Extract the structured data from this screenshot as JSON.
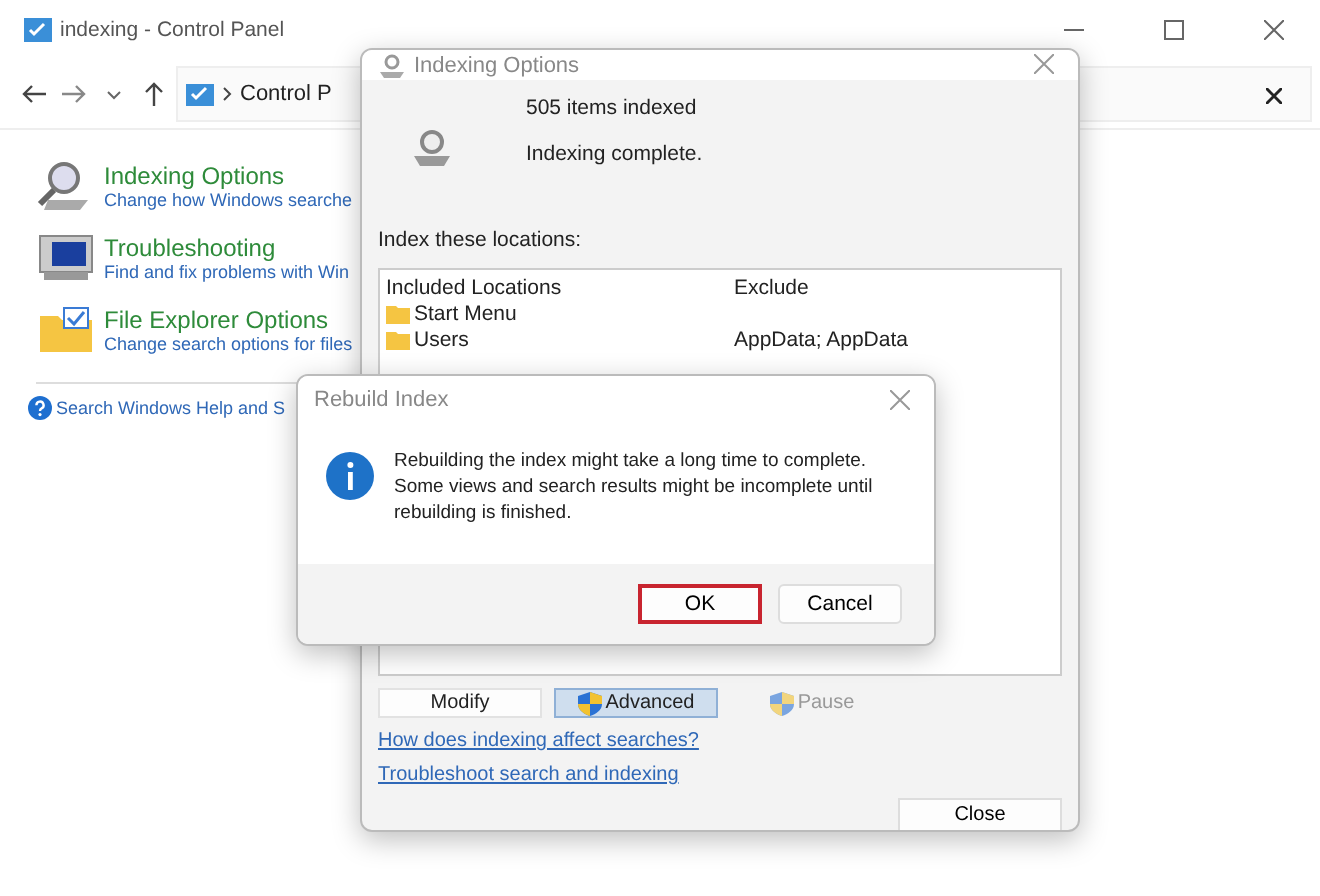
{
  "window": {
    "title": "indexing - Control Panel",
    "address": "Control P"
  },
  "items": [
    {
      "kind": "search",
      "title": "Indexing Options",
      "desc": "Change how Windows searche"
    },
    {
      "kind": "monitor",
      "title": "Troubleshooting",
      "desc": "Find and fix problems with Win"
    },
    {
      "kind": "folder",
      "title": "File Explorer Options",
      "desc": "Change search options for files"
    }
  ],
  "help_link": "Search Windows Help and S",
  "indexing_dialog": {
    "title": "Indexing Options",
    "count": "505 items indexed",
    "status": "Indexing complete.",
    "locations_label": "Index these locations:",
    "columns": [
      "Included Locations",
      "Exclude"
    ],
    "rows": [
      {
        "location": "Start Menu"
      },
      {
        "location": "Users",
        "exclude": "AppData; AppData"
      }
    ],
    "buttons": [
      {
        "label": "Modify",
        "shield": false,
        "highlighted": false,
        "disabled": false
      },
      {
        "label": "Advanced",
        "shield": true,
        "highlighted": true,
        "disabled": false
      },
      {
        "label": "Pause",
        "shield": true,
        "highlighted": false,
        "disabled": true
      }
    ],
    "links": [
      "How does indexing affect searches?",
      "Troubleshoot search and indexing"
    ],
    "close_button": "Close"
  },
  "rebuild_dialog": {
    "title": "Rebuild Index",
    "message": "Rebuilding the index might take a long time to complete. Some views and search results might be incomplete until rebuilding is finished.",
    "buttons": [
      {
        "label": "OK",
        "focused": true
      },
      {
        "label": "Cancel",
        "focused": false
      }
    ]
  }
}
